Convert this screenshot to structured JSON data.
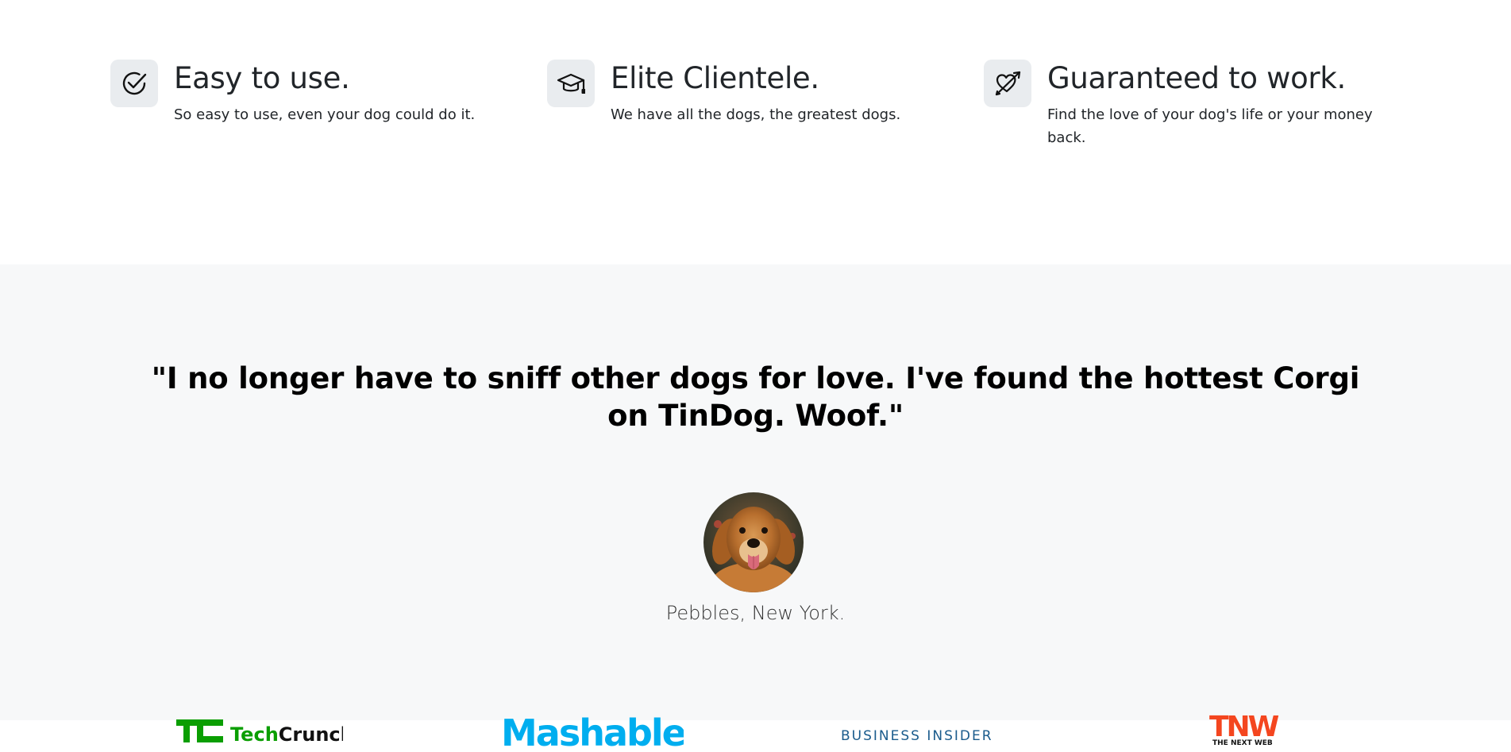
{
  "features": [
    {
      "title": "Easy to use.",
      "description": "So easy to use, even your dog could do it.",
      "icon": "check-circle-icon"
    },
    {
      "title": "Elite Clientele.",
      "description": "We have all the dogs, the greatest dogs.",
      "icon": "graduation-cap-icon"
    },
    {
      "title": "Guaranteed to work.",
      "description": "Find the love of your dog's life or your money back.",
      "icon": "heart-arrow-icon"
    }
  ],
  "testimonial": {
    "quote": "\"I no longer have to sniff other dogs for love. I've found the hottest Corgi on TinDog. Woof.\"",
    "author": "Pebbles, New York."
  },
  "press_logos": {
    "techcrunch": {
      "mark": "TC",
      "prefix": "Tech",
      "suffix": "Crunch"
    },
    "mashable": "Mashable",
    "business_insider": "BUSINESS INSIDER",
    "tnw": {
      "mark": "TNW",
      "sub": "THE NEXT WEB"
    }
  },
  "colors": {
    "icon_bg": "#e9ecef",
    "testimonial_bg": "#f7f8f9",
    "techcrunch_green": "#0a9e01",
    "mashable_blue": "#00aeef",
    "business_insider_blue": "#1a5b8c",
    "tnw_red": "#f4461f"
  }
}
